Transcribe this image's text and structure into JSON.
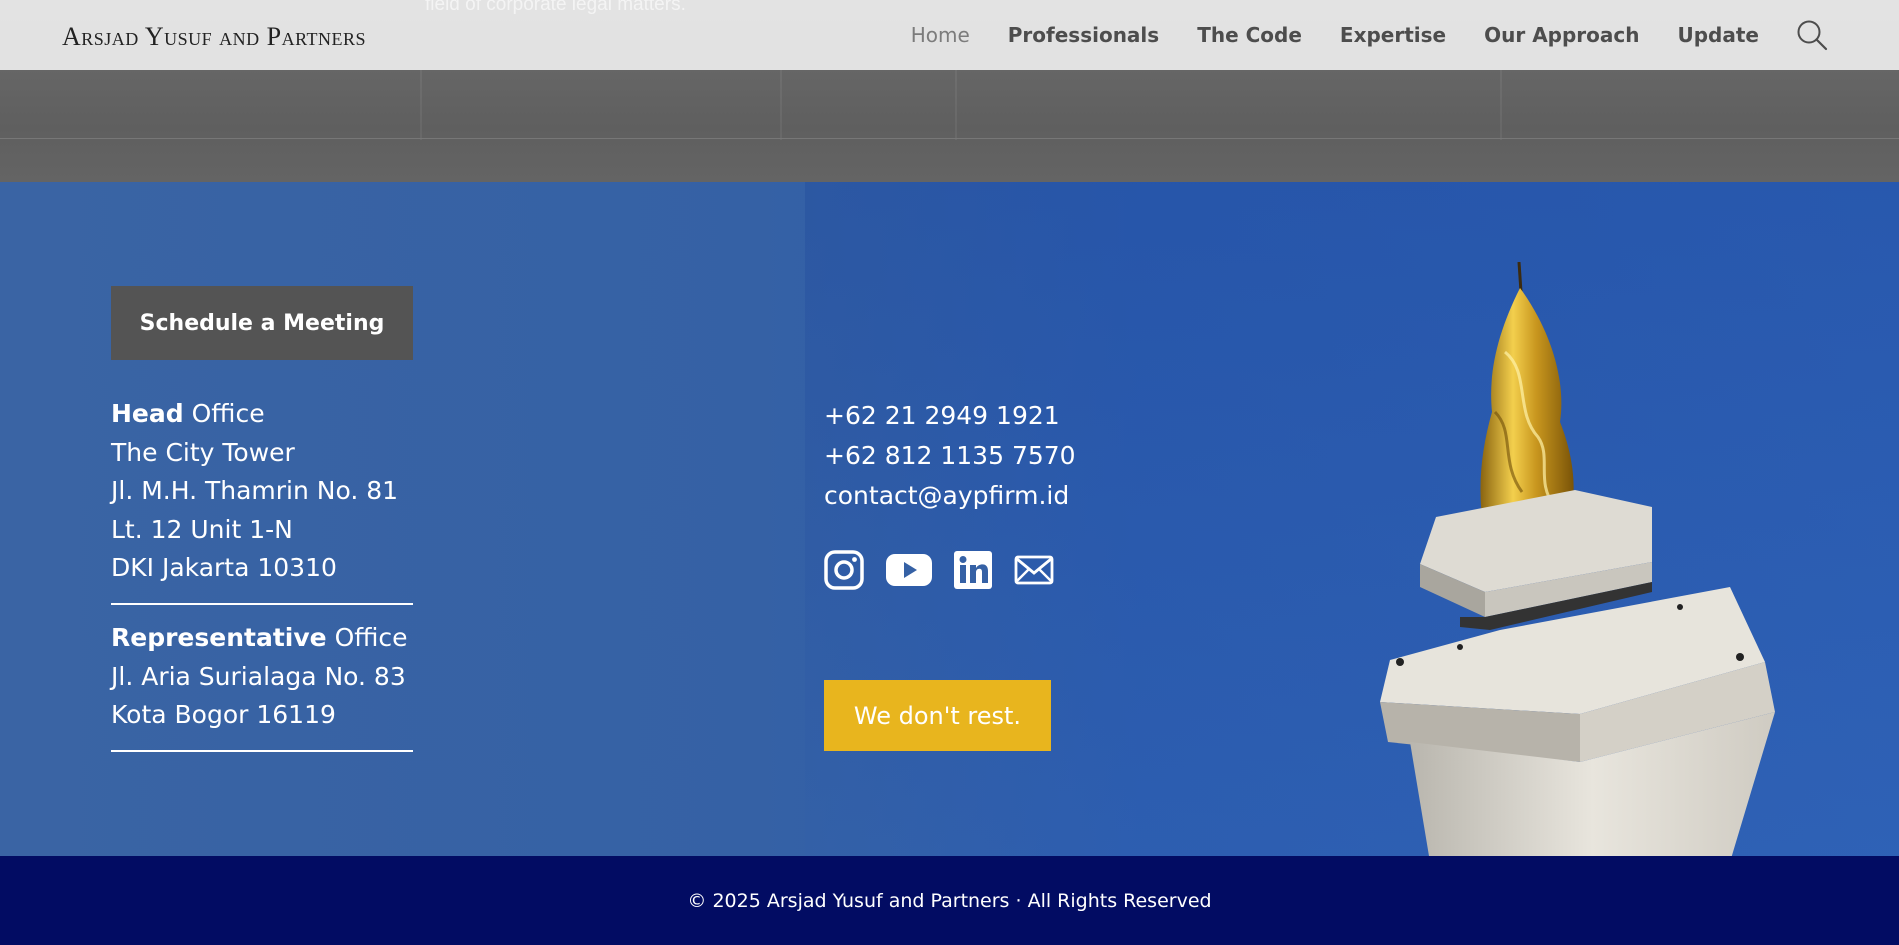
{
  "hero": {
    "caption": "field of corporate legal matters."
  },
  "header": {
    "logo_text": "Arsjad Yusuf and Partners",
    "nav": [
      {
        "label": "Home",
        "active": true
      },
      {
        "label": "Professionals"
      },
      {
        "label": "The Code"
      },
      {
        "label": "Expertise"
      },
      {
        "label": "Our Approach"
      },
      {
        "label": "Update"
      }
    ],
    "search_icon": "search-icon"
  },
  "contact": {
    "schedule_label": "Schedule a Meeting",
    "head_office": {
      "title_bold": "Head",
      "title_rest": " Office",
      "lines": [
        "The City Tower",
        "Jl. M.H. Thamrin No. 81",
        "Lt. 12 Unit 1-N",
        "DKI Jakarta 10310"
      ]
    },
    "rep_office": {
      "title_bold": "Representative",
      "title_rest": " Office",
      "lines": [
        "Jl. Aria Surialaga No. 83",
        "Kota Bogor 16119"
      ]
    },
    "phone_1": "+62 21 2949 1921",
    "phone_2": "+62 812 1135 7570",
    "email": "contact@aypfirm.id",
    "socials": [
      "instagram-icon",
      "youtube-icon",
      "linkedin-icon",
      "email-icon"
    ],
    "cta_label": "We don't rest."
  },
  "footer": {
    "copyright": "© 2025 Arsjad Yusuf and Partners · All Rights Reserved"
  },
  "colors": {
    "cta": "#e8b51e",
    "schedule_button": "#545454",
    "footer": "#020c63",
    "section_blue": "#3561a5"
  }
}
